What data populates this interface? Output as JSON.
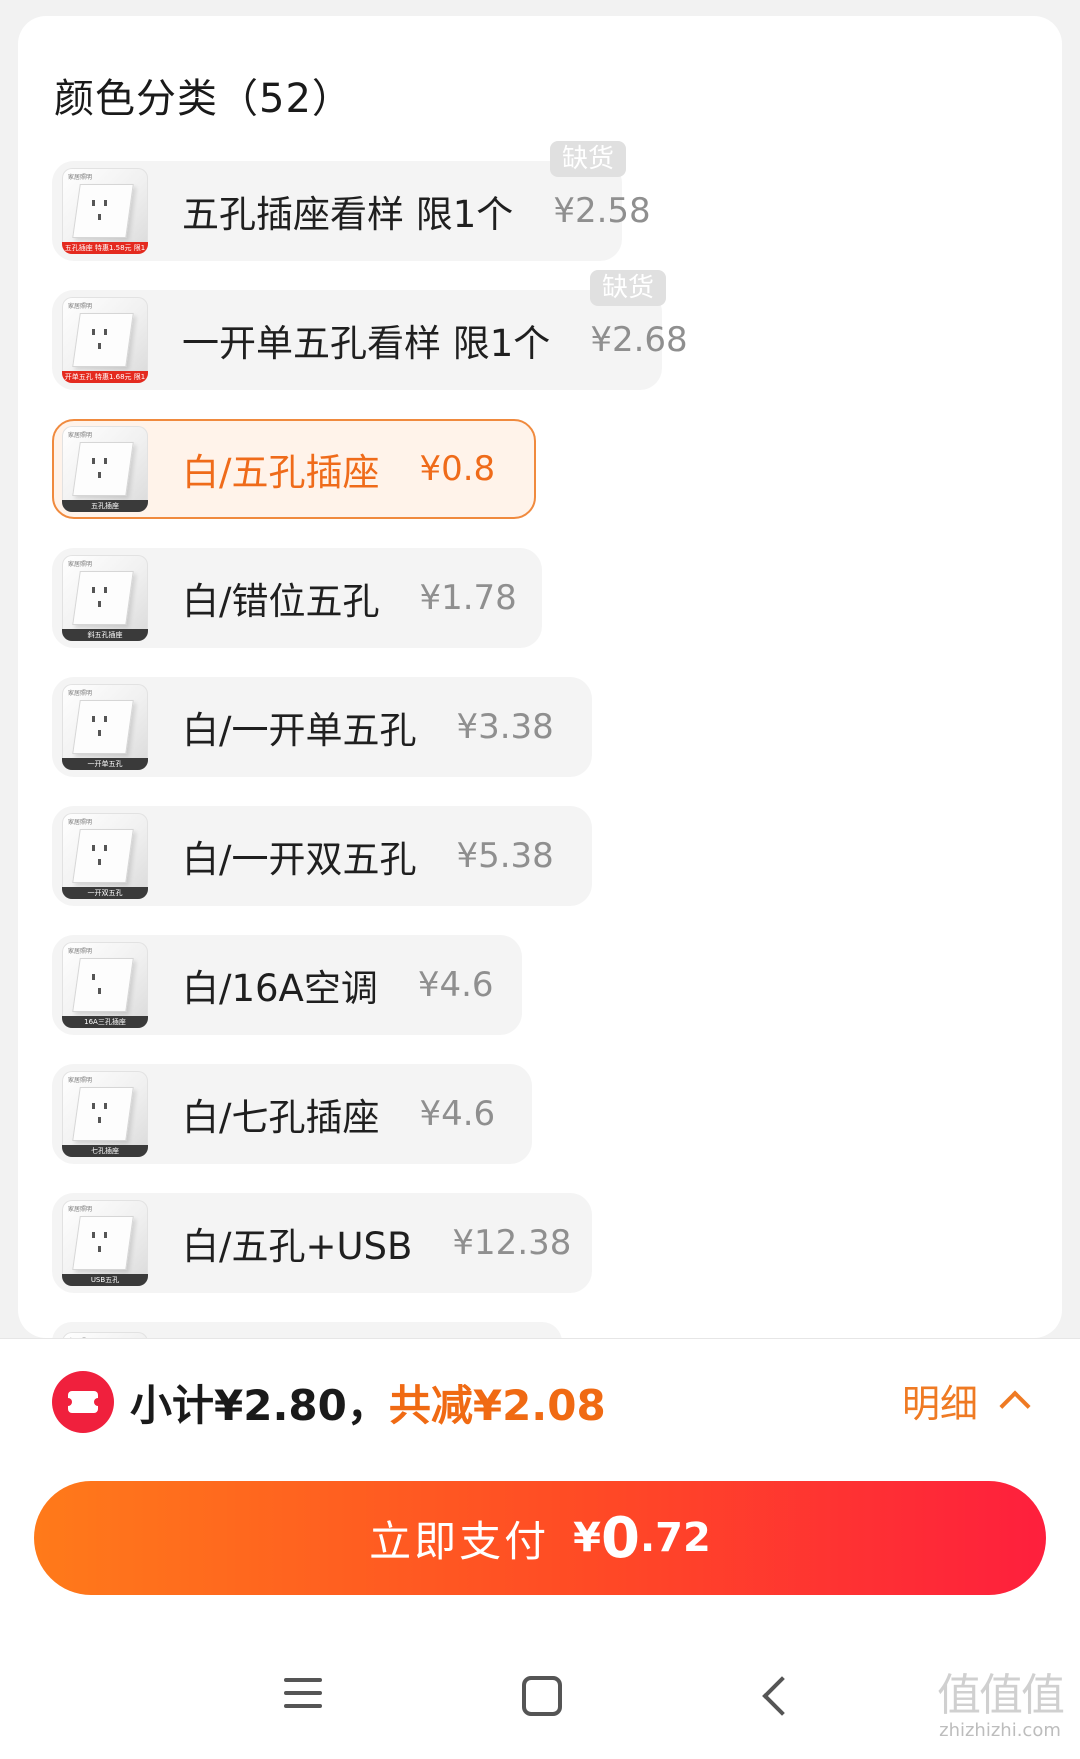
{
  "section": {
    "title": "颜色分类（52）"
  },
  "options": [
    {
      "label": "五孔插座看样 限1个",
      "price": "¥2.58",
      "badge": "缺货",
      "thumb_caption": "五孔插座 特惠1.58元 限1",
      "selected": false
    },
    {
      "label": "一开单五孔看样 限1个",
      "price": "¥2.68",
      "badge": "缺货",
      "thumb_caption": "开单五孔 特惠1.68元 限1",
      "selected": false
    },
    {
      "label": "白/五孔插座",
      "price": "¥0.8",
      "badge": "",
      "thumb_caption": "五孔插座",
      "selected": true
    },
    {
      "label": "白/错位五孔",
      "price": "¥1.78",
      "badge": "",
      "thumb_caption": "斜五孔插座",
      "selected": false
    },
    {
      "label": "白/一开单五孔",
      "price": "¥3.38",
      "badge": "",
      "thumb_caption": "一开单五孔",
      "selected": false
    },
    {
      "label": "白/一开双五孔",
      "price": "¥5.38",
      "badge": "",
      "thumb_caption": "一开双五孔",
      "selected": false
    },
    {
      "label": "白/16A空调",
      "price": "¥4.6",
      "badge": "",
      "thumb_caption": "16A三孔插座",
      "selected": false
    },
    {
      "label": "白/七孔插座",
      "price": "¥4.6",
      "badge": "",
      "thumb_caption": "七孔插座",
      "selected": false
    },
    {
      "label": "白/五孔+USB",
      "price": "¥12.38",
      "badge": "",
      "thumb_caption": "USB五孔",
      "selected": false
    }
  ],
  "summary": {
    "subtotal": "小计¥2.80，",
    "discount": "共减¥2.08",
    "detail_label": "明细"
  },
  "pay": {
    "label": "立即支付",
    "currency": "¥",
    "amount_int": "0",
    "amount_dec": ".72"
  },
  "colors": {
    "accent_orange": "#ef6b1a",
    "button_gradient_start": "#ff7a1a",
    "button_gradient_end": "#fe1f3d",
    "coupon_red": "#f0203d",
    "badge_gray": "#e0e0e0"
  },
  "icons": [
    "coupon-icon",
    "chevron-up-icon",
    "menu-icon",
    "home-icon",
    "back-icon"
  ],
  "watermark": {
    "logo": "值值值",
    "url": "zhizhizhi.com"
  }
}
